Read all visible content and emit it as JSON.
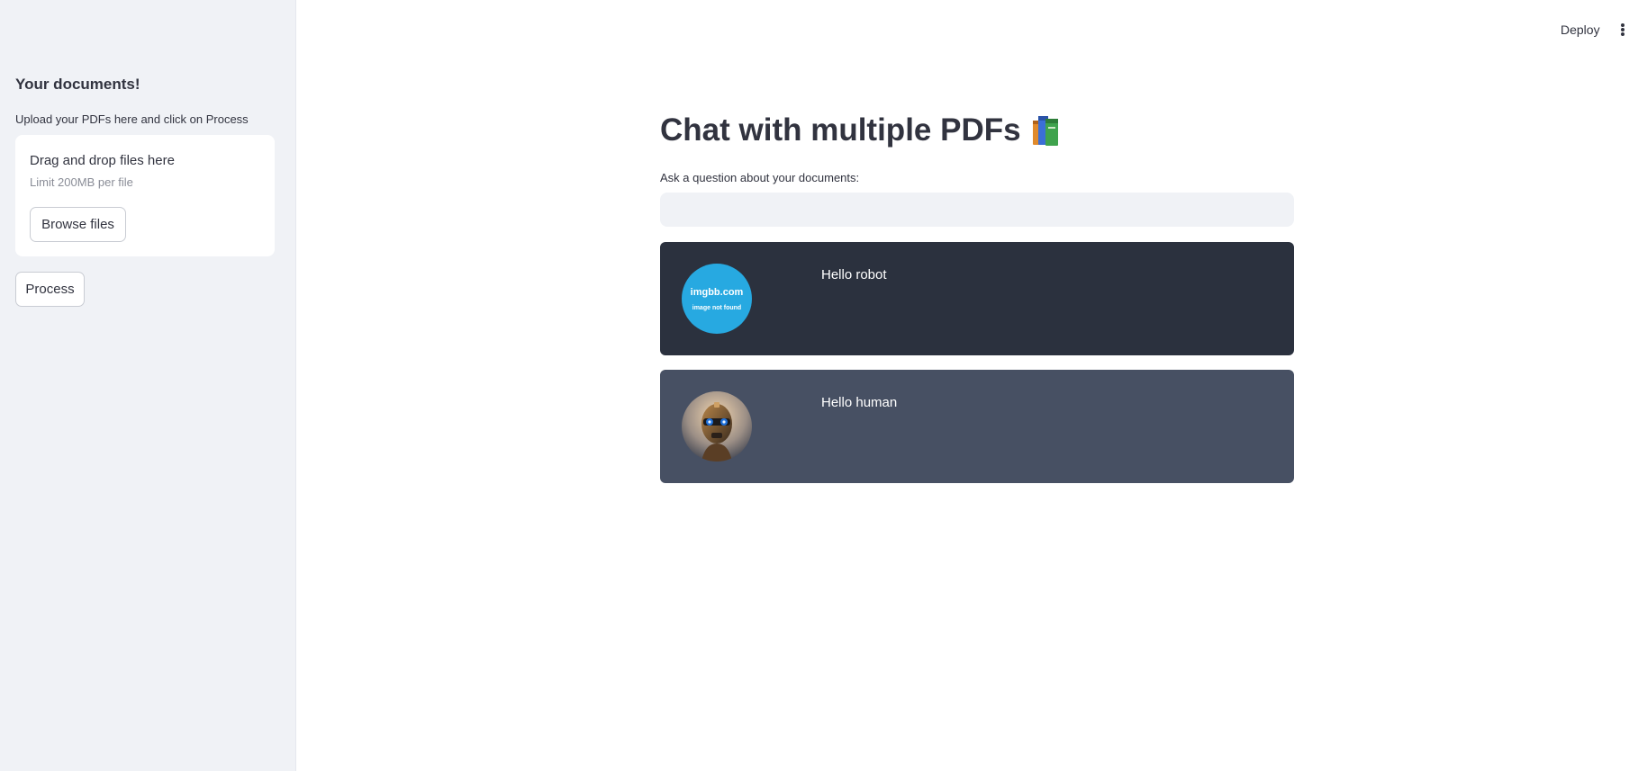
{
  "sidebar": {
    "title": "Your documents!",
    "description": "Upload your PDFs here and click on Process",
    "uploader": {
      "title": "Drag and drop files here",
      "limit": "Limit 200MB per file",
      "browse_label": "Browse files"
    },
    "process_label": "Process"
  },
  "header": {
    "deploy_label": "Deploy",
    "menu_icon": "vertical-dots-icon"
  },
  "main": {
    "title": "Chat with multiple PDFs",
    "title_icon": "books-icon",
    "question_label": "Ask a question about your documents:",
    "question_value": "",
    "messages": [
      {
        "role": "user",
        "avatar_text": "imgbb.com",
        "avatar_subtext": "image not found",
        "text": "Hello robot",
        "background": "#2b313e"
      },
      {
        "role": "bot",
        "avatar_icon": "robot-avatar-icon",
        "text": "Hello human",
        "background": "#475063"
      }
    ]
  },
  "colors": {
    "sidebar_bg": "#f0f2f6",
    "text": "#31333f",
    "imgbb_blue": "#27a9e1"
  }
}
